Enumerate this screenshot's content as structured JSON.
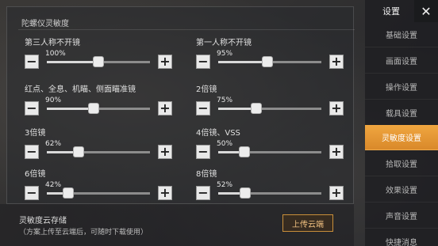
{
  "section": {
    "title": "陀螺仪灵敏度"
  },
  "settings": [
    {
      "label": "第三人称不开镜",
      "value": "100%",
      "level": 0.5
    },
    {
      "label": "第一人称不开镜",
      "value": "95%",
      "level": 0.48
    },
    {
      "label": "红点、全息、机瞄、侧面瞄准镜",
      "value": "90%",
      "level": 0.45
    },
    {
      "label": "2倍镜",
      "value": "75%",
      "level": 0.37
    },
    {
      "label": "3倍镜",
      "value": "62%",
      "level": 0.31
    },
    {
      "label": "4倍镜、VSS",
      "value": "50%",
      "level": 0.25
    },
    {
      "label": "6倍镜",
      "value": "42%",
      "level": 0.21
    },
    {
      "label": "8倍镜",
      "value": "52%",
      "level": 0.26
    }
  ],
  "cloud": {
    "title": "灵敏度云存储",
    "subtitle": "（方案上传至云端后，可随时下载使用）",
    "upload_label": "上传云端"
  },
  "sidebar": {
    "title": "设置",
    "close_label": "✕",
    "items": [
      {
        "label": "基础设置",
        "active": false
      },
      {
        "label": "画面设置",
        "active": false
      },
      {
        "label": "操作设置",
        "active": false
      },
      {
        "label": "载具设置",
        "active": false
      },
      {
        "label": "灵敏度设置",
        "active": true
      },
      {
        "label": "拾取设置",
        "active": false
      },
      {
        "label": "效果设置",
        "active": false
      },
      {
        "label": "声音设置",
        "active": false
      },
      {
        "label": "快捷消息",
        "active": false
      }
    ]
  },
  "colors": {
    "accent": "#e89a35",
    "upload_border": "#c98f3a"
  }
}
